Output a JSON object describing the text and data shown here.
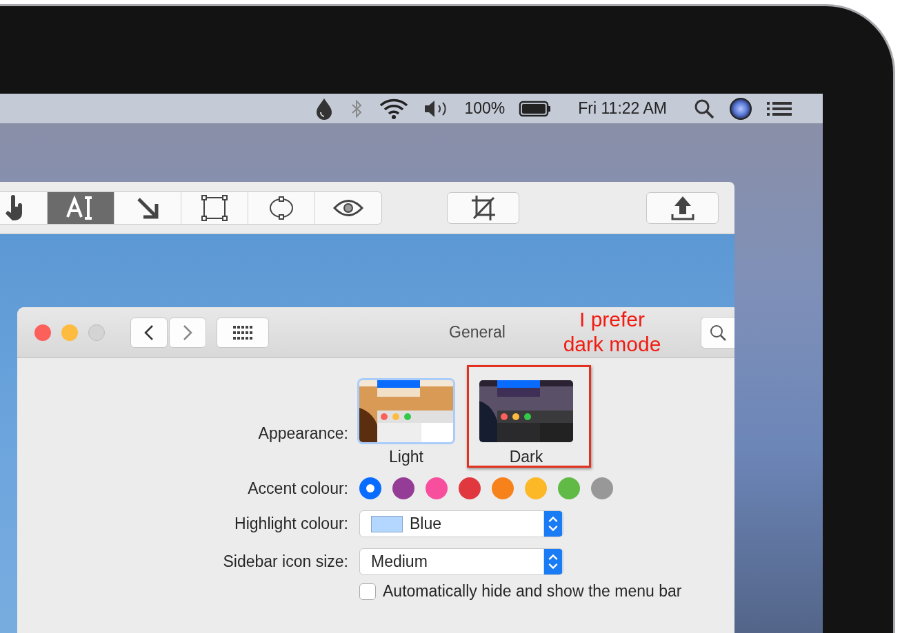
{
  "menu_bar": {
    "battery": "100%",
    "clock": "Fri 11:22 AM"
  },
  "markup_toolbar": {
    "tools": [
      {
        "kind": "hand",
        "selected": false
      },
      {
        "kind": "text",
        "selected": true
      },
      {
        "kind": "arrow",
        "selected": false
      },
      {
        "kind": "rectangle",
        "selected": false
      },
      {
        "kind": "oval",
        "selected": false
      },
      {
        "kind": "eye",
        "selected": false
      }
    ]
  },
  "preferences_window": {
    "title": "General",
    "annotation": "I prefer\ndark mode",
    "appearance": {
      "label": "Appearance:",
      "options": [
        {
          "label": "Light",
          "kind": "light",
          "selected": true,
          "circled": false
        },
        {
          "label": "Dark",
          "kind": "dark",
          "selected": false,
          "circled": true
        }
      ]
    },
    "accent_colour": {
      "label": "Accent colour:",
      "colors": [
        {
          "color": "#0a6cff",
          "selected": true
        },
        {
          "color": "#953d96",
          "selected": false
        },
        {
          "color": "#f74f9e",
          "selected": false
        },
        {
          "color": "#e0383e",
          "selected": false
        },
        {
          "color": "#f7821b",
          "selected": false
        },
        {
          "color": "#fcb827",
          "selected": false
        },
        {
          "color": "#62ba46",
          "selected": false
        },
        {
          "color": "#989898",
          "selected": false
        }
      ]
    },
    "highlight_colour": {
      "label": "Highlight colour:",
      "value": "Blue",
      "color": "#b3d7ff"
    },
    "sidebar_icon_size": {
      "label": "Sidebar icon size:",
      "value": "Medium"
    },
    "menu_bar_option": {
      "label": "Automatically hide and show the menu bar",
      "checked": false
    }
  }
}
